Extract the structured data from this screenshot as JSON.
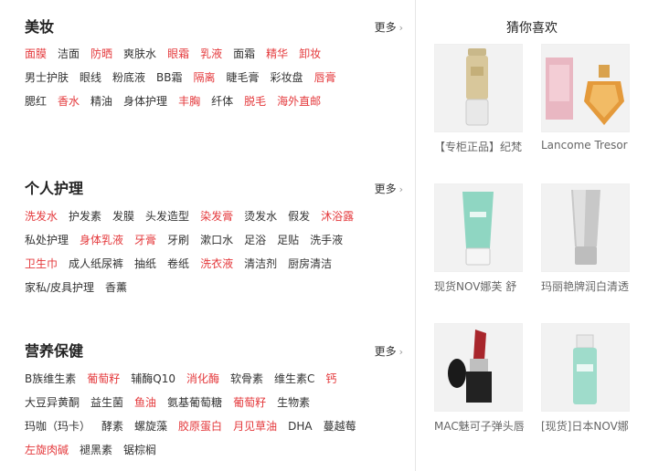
{
  "sections": [
    {
      "title": "美妆",
      "more": "更多",
      "rows": [
        [
          {
            "t": "面膜",
            "hot": true
          },
          {
            "t": "洁面",
            "hot": false
          },
          {
            "t": "防晒",
            "hot": true
          },
          {
            "t": "爽肤水",
            "hot": false
          },
          {
            "t": "眼霜",
            "hot": true
          },
          {
            "t": "乳液",
            "hot": true
          },
          {
            "t": "面霜",
            "hot": false
          },
          {
            "t": "精华",
            "hot": true
          },
          {
            "t": "卸妆",
            "hot": true
          }
        ],
        [
          {
            "t": "男士护肤",
            "hot": false
          },
          {
            "t": "眼线",
            "hot": false
          },
          {
            "t": "粉底液",
            "hot": false
          },
          {
            "t": "BB霜",
            "hot": false
          },
          {
            "t": "隔离",
            "hot": true
          },
          {
            "t": "睫毛膏",
            "hot": false
          },
          {
            "t": "彩妆盘",
            "hot": false
          },
          {
            "t": "唇膏",
            "hot": true
          }
        ],
        [
          {
            "t": "腮红",
            "hot": false
          },
          {
            "t": "香水",
            "hot": true
          },
          {
            "t": "精油",
            "hot": false
          },
          {
            "t": "身体护理",
            "hot": false
          },
          {
            "t": "丰胸",
            "hot": true
          },
          {
            "t": "纤体",
            "hot": false
          },
          {
            "t": "脱毛",
            "hot": true
          },
          {
            "t": "海外直邮",
            "hot": true
          }
        ]
      ]
    },
    {
      "title": "个人护理",
      "more": "更多",
      "rows": [
        [
          {
            "t": "洗发水",
            "hot": true
          },
          {
            "t": "护发素",
            "hot": false
          },
          {
            "t": "发膜",
            "hot": false
          },
          {
            "t": "头发造型",
            "hot": false
          },
          {
            "t": "染发膏",
            "hot": true
          },
          {
            "t": "烫发水",
            "hot": false
          },
          {
            "t": "假发",
            "hot": false
          },
          {
            "t": "沐浴露",
            "hot": true
          }
        ],
        [
          {
            "t": "私处护理",
            "hot": false
          },
          {
            "t": "身体乳液",
            "hot": true
          },
          {
            "t": "牙膏",
            "hot": true
          },
          {
            "t": "牙刷",
            "hot": false
          },
          {
            "t": "漱口水",
            "hot": false
          },
          {
            "t": "足浴",
            "hot": false
          },
          {
            "t": "足贴",
            "hot": false
          },
          {
            "t": "洗手液",
            "hot": false
          }
        ],
        [
          {
            "t": "卫生巾",
            "hot": true
          },
          {
            "t": "成人纸尿裤",
            "hot": false
          },
          {
            "t": "抽纸",
            "hot": false
          },
          {
            "t": "卷纸",
            "hot": false
          },
          {
            "t": "洗衣液",
            "hot": true
          },
          {
            "t": "清洁剂",
            "hot": false
          },
          {
            "t": "厨房清洁",
            "hot": false
          }
        ],
        [
          {
            "t": "家私/皮具护理",
            "hot": false
          },
          {
            "t": "香薰",
            "hot": false
          }
        ]
      ]
    },
    {
      "title": "营养保健",
      "more": "更多",
      "rows": [
        [
          {
            "t": "B族维生素",
            "hot": false
          },
          {
            "t": "葡萄籽",
            "hot": true
          },
          {
            "t": "辅酶Q10",
            "hot": false
          },
          {
            "t": "消化酶",
            "hot": true
          },
          {
            "t": "软骨素",
            "hot": false
          },
          {
            "t": "维生素C",
            "hot": false
          },
          {
            "t": "钙",
            "hot": true
          }
        ],
        [
          {
            "t": "大豆异黄酮",
            "hot": false
          },
          {
            "t": "益生菌",
            "hot": false
          },
          {
            "t": "鱼油",
            "hot": true
          },
          {
            "t": "氨基葡萄糖",
            "hot": false
          },
          {
            "t": "葡萄籽",
            "hot": true
          },
          {
            "t": "生物素",
            "hot": false
          }
        ],
        [
          {
            "t": "玛咖（玛卡）",
            "hot": false
          },
          {
            "t": "酵素",
            "hot": false
          },
          {
            "t": "螺旋藻",
            "hot": false
          },
          {
            "t": "胶原蛋白",
            "hot": true
          },
          {
            "t": "月见草油",
            "hot": true
          },
          {
            "t": "DHA",
            "hot": false
          },
          {
            "t": "蔓越莓",
            "hot": false
          }
        ],
        [
          {
            "t": "左旋肉碱",
            "hot": true
          },
          {
            "t": "褪黑素",
            "hot": false
          },
          {
            "t": "锯棕榈",
            "hot": false
          }
        ]
      ]
    }
  ],
  "guess": {
    "title": "猜你喜欢",
    "products": [
      {
        "name": "【专柜正品】纪梵",
        "icon": "foundation-tube-image"
      },
      {
        "name": "Lancome Tresor",
        "icon": "perfume-bottle-image"
      },
      {
        "name": "现货NOV娜芙 舒",
        "icon": "sunscreen-tube-image"
      },
      {
        "name": "玛丽艳牌润白清透",
        "icon": "silver-tube-image"
      },
      {
        "name": "MAC魅可子弹头唇",
        "icon": "lipstick-image"
      },
      {
        "name": "[现货]日本NOV娜",
        "icon": "lotion-bottle-image"
      }
    ]
  },
  "colors": {
    "hot": "#e4393c",
    "normal": "#333333"
  }
}
